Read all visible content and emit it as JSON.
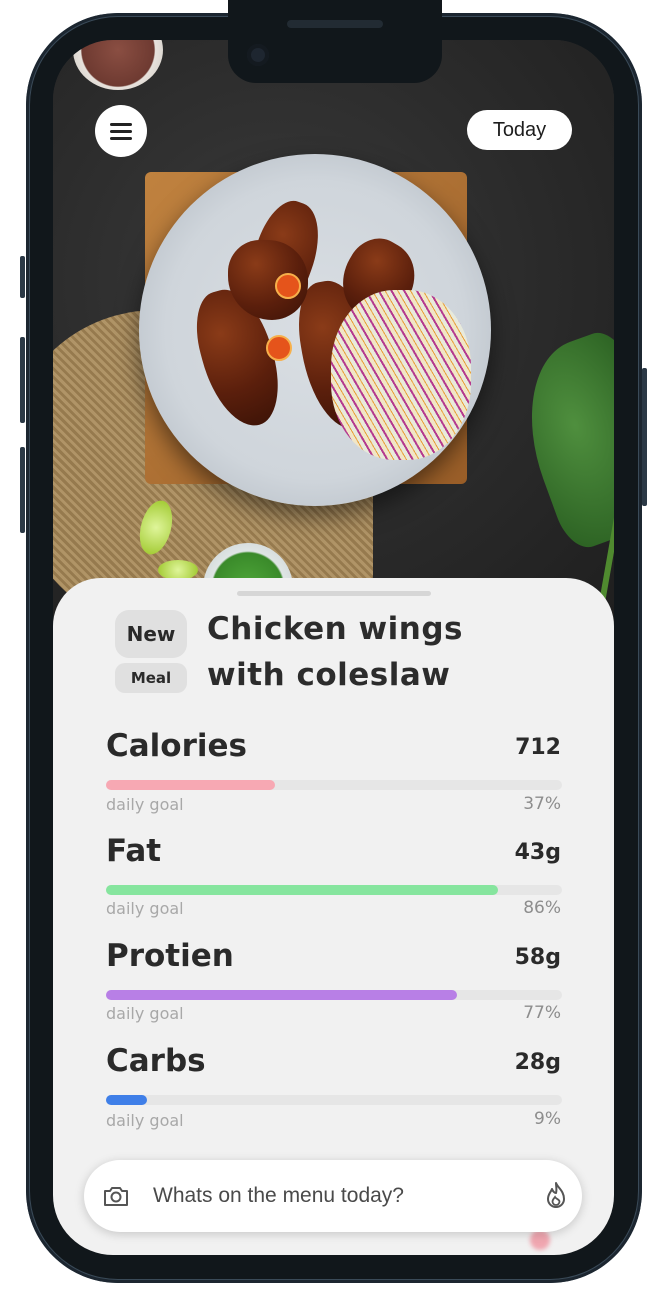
{
  "header": {
    "menu_icon": "hamburger-menu-icon",
    "date_filter_label": "Today"
  },
  "meal": {
    "badge_new": "New",
    "badge_meal": "Meal",
    "title_line1": "Chicken wings",
    "title_line2": "with coleslaw"
  },
  "nutrients": [
    {
      "name": "Calories",
      "value": "712",
      "goal_label": "daily goal",
      "percent_label": "37%",
      "percent": 37,
      "color": "#f7a8b3"
    },
    {
      "name": "Fat",
      "value": "43g",
      "goal_label": "daily goal",
      "percent_label": "86%",
      "percent": 86,
      "color": "#86e59e"
    },
    {
      "name": "Protien",
      "value": "58g",
      "goal_label": "daily goal",
      "percent_label": "77%",
      "percent": 77,
      "color": "#b87fe6"
    },
    {
      "name": "Carbs",
      "value": "28g",
      "goal_label": "daily goal",
      "percent_label": "9%",
      "percent": 9,
      "color": "#3f7fe8"
    }
  ],
  "search": {
    "placeholder": "Whats on the menu today?",
    "camera_icon": "camera-icon",
    "submit_icon": "flame-icon"
  },
  "colors": {
    "sheet_background": "#f1f1f1",
    "frame": "#3a4a58"
  }
}
